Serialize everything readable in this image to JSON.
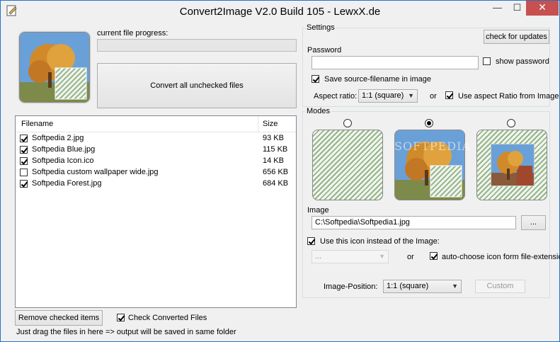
{
  "window": {
    "title": "Convert2Image V2.0 Build 105 - LewxX.de",
    "min_glyph": "—",
    "max_glyph": "☐",
    "close_glyph": "✕"
  },
  "left": {
    "progress_label": "current file progress:",
    "progress_value": 0,
    "convert_button": "Convert all unchecked files",
    "columns": {
      "filename": "Filename",
      "size": "Size"
    },
    "files": [
      {
        "name": "Softpedia 2.jpg",
        "size": "93 KB",
        "checked": true
      },
      {
        "name": "Softpedia Blue.jpg",
        "size": "115 KB",
        "checked": true
      },
      {
        "name": "Softpedia Icon.ico",
        "size": "14 KB",
        "checked": true
      },
      {
        "name": "Softpedia custom wallpaper wide.jpg",
        "size": "656 KB",
        "checked": false
      },
      {
        "name": "Softpedia Forest.jpg",
        "size": "684 KB",
        "checked": true
      }
    ],
    "remove_button": "Remove checked items",
    "check_converted": {
      "label": "Check Converted Files",
      "checked": true
    },
    "footer_hint": "Just drag the files in here => output will be saved in same folder"
  },
  "settings": {
    "group_label": "Settings",
    "check_updates": "check for updates",
    "password_label": "Password",
    "password_value": "",
    "show_password": {
      "label": "show password",
      "checked": false
    },
    "save_filename": {
      "label": "Save source-filename in image",
      "checked": true
    },
    "aspect_label": "Aspect ratio:",
    "aspect_value": "1:1 (square)",
    "or_text": "or",
    "use_aspect": {
      "label": "Use aspect Ratio from Image",
      "checked": true
    }
  },
  "modes": {
    "group_label": "Modes",
    "selected": 1,
    "watermark": "SOFTPEDIA",
    "image_label": "Image",
    "image_path": "C:\\Softpedia\\Softpedia1.jpg",
    "browse_button": "...",
    "use_icon": {
      "label": "Use this icon instead of the Image:",
      "checked": true
    },
    "icon_select": "...",
    "or_text": "or",
    "auto_choose": {
      "label": "auto-choose icon form file-extension",
      "checked": true
    },
    "position_label": "Image-Position:",
    "position_value": "1:1 (square)",
    "custom_button": "Custom"
  },
  "colors": {
    "titlebar": "#f0f0f0",
    "close_button": "#c75050",
    "hatch_green": "#93b489",
    "sky": "#6aa0d8",
    "foliage": "#d08a2a"
  }
}
